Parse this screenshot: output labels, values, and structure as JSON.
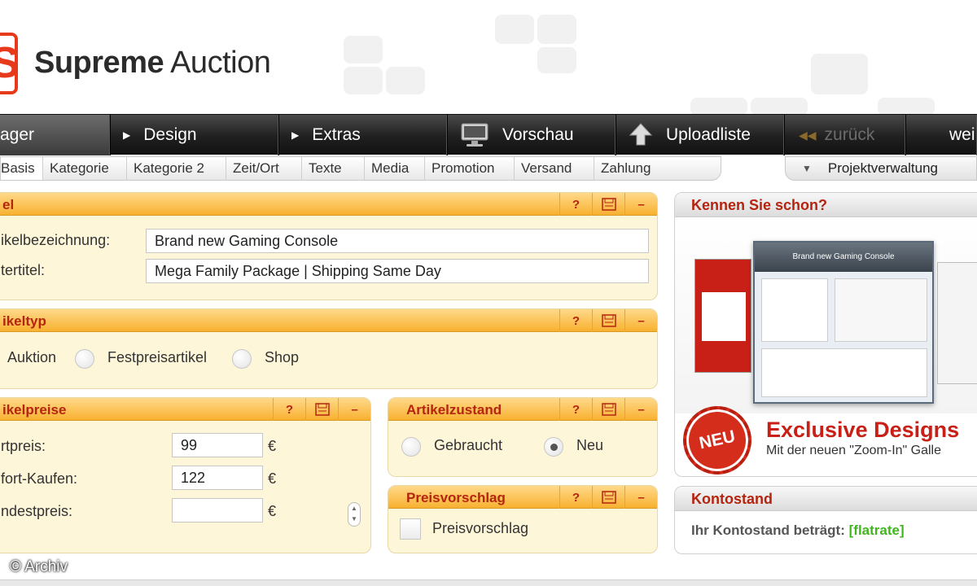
{
  "brand": {
    "logo_letter": "S",
    "name_bold": "Supreme",
    "name_rest": " Auction"
  },
  "navbar": {
    "items": [
      {
        "label": "ager"
      },
      {
        "label": "Design"
      },
      {
        "label": "Extras"
      },
      {
        "label": "Vorschau"
      },
      {
        "label": "Uploadliste"
      },
      {
        "label": "zurück"
      },
      {
        "label": "wei"
      }
    ]
  },
  "subnav": {
    "tabs": [
      "Basis",
      "Kategorie",
      "Kategorie 2",
      "Zeit/Ort",
      "Texte",
      "Media",
      "Promotion",
      "Versand",
      "Zahlung"
    ],
    "projekt_label": "Projektverwaltung"
  },
  "panel_titel": {
    "title": "el",
    "label_bezeichnung": "ikelbezeichnung:",
    "value_bezeichnung": "Brand new Gaming Console",
    "label_untertitel": "tertitel:",
    "value_untertitel": "Mega Family Package | Shipping Same Day"
  },
  "panel_artikeltyp": {
    "title": "ikeltyp",
    "options": [
      "Auktion",
      "Festpreisartikel",
      "Shop"
    ]
  },
  "panel_preise": {
    "title": "ikelpreise",
    "label_start": "rtpreis:",
    "value_start": "99",
    "label_sofort": "fort-Kaufen:",
    "value_sofort": "122",
    "label_mindest": "ndestpreis:",
    "value_mindest": "",
    "currency": "€"
  },
  "panel_zustand": {
    "title": "Artikelzustand",
    "option_gebraucht": "Gebraucht",
    "option_neu": "Neu",
    "selected": "Neu"
  },
  "panel_preisvorschlag": {
    "title": "Preisvorschlag",
    "checkbox_label": "Preisvorschlag",
    "checked": false
  },
  "panel_tools": {
    "help": "?",
    "minimize": "–"
  },
  "promo": {
    "title": "Kennen Sie schon?",
    "preview_title": "Brand new Gaming Console",
    "badge": "NEU",
    "headline": "Exclusive Designs",
    "subline": "Mit der neuen \"Zoom-In\" Galle"
  },
  "konto": {
    "title": "Kontostand",
    "text": "Ihr Kontostand beträgt:",
    "value": "[flatrate]"
  },
  "watermark": "© Archiv",
  "colors": {
    "accent_red": "#b5240f",
    "panel_orange": "#f8b130",
    "nav_dark": "#202020",
    "flatrate_green": "#3fb61e"
  }
}
